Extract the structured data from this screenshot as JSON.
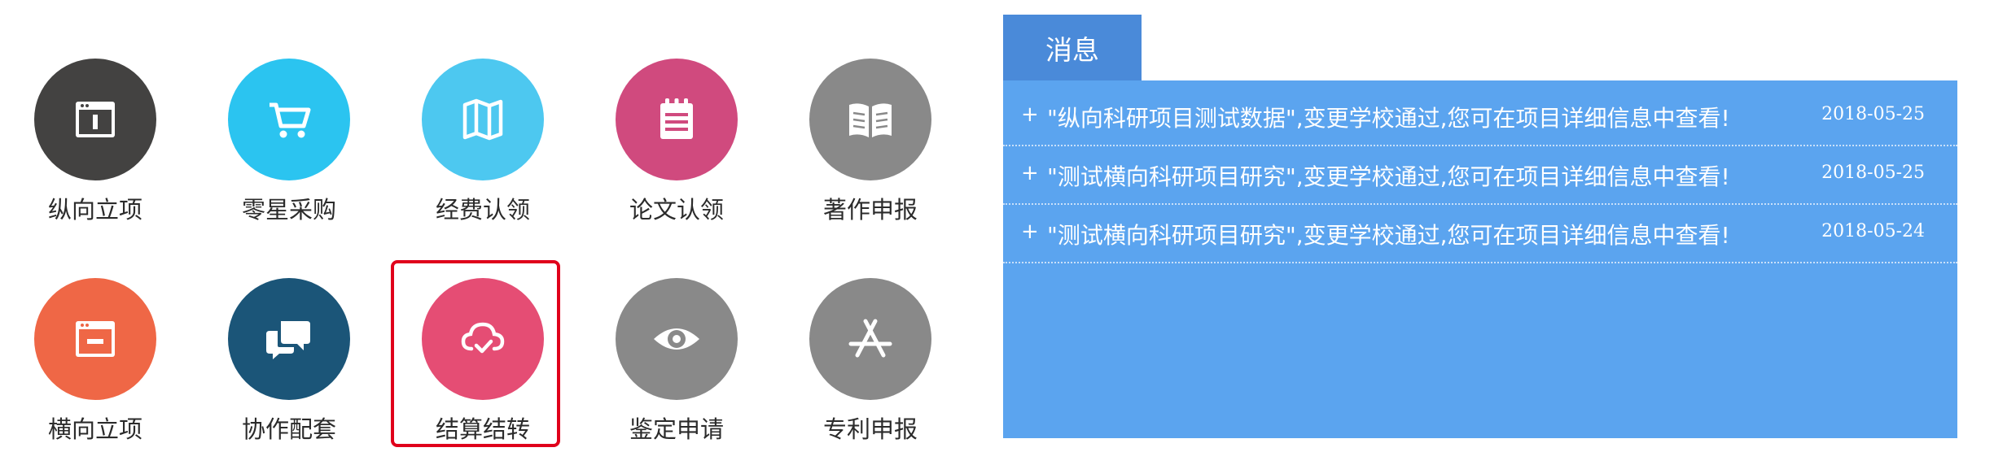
{
  "tiles": [
    {
      "label": "纵向立项",
      "icon": "window-icon",
      "color": "#434241"
    },
    {
      "label": "零星采购",
      "icon": "cart-icon",
      "color": "#2bc4f0"
    },
    {
      "label": "经费认领",
      "icon": "map-icon",
      "color": "#4dc8f0"
    },
    {
      "label": "论文认领",
      "icon": "notepad-icon",
      "color": "#d04a7e"
    },
    {
      "label": "著作申报",
      "icon": "book-icon",
      "color": "#898989"
    },
    {
      "label": "横向立项",
      "icon": "window-minus-icon",
      "color": "#ef6746"
    },
    {
      "label": "协作配套",
      "icon": "chat-icon",
      "color": "#1b5578"
    },
    {
      "label": "结算结转",
      "icon": "cloud-check-icon",
      "color": "#e54d74"
    },
    {
      "label": "鉴定申请",
      "icon": "eye-icon",
      "color": "#898989"
    },
    {
      "label": "专利申报",
      "icon": "appstore-icon",
      "color": "#898989"
    }
  ],
  "messages": {
    "tab_label": "消息",
    "items": [
      {
        "bullet": "+",
        "text": "\"纵向科研项目测试数据\",变更学校通过,您可在项目详细信息中查看!",
        "date": "2018-05-25"
      },
      {
        "bullet": "+",
        "text": "\"测试横向科研项目研究\",变更学校通过,您可在项目详细信息中查看!",
        "date": "2018-05-25"
      },
      {
        "bullet": "+",
        "text": "\"测试横向科研项目研究\",变更学校通过,您可在项目详细信息中查看!",
        "date": "2018-05-24"
      }
    ]
  },
  "colors": {
    "panel": "#5ba4ef",
    "tab": "#4a8ad9",
    "highlight": "#e0001b"
  }
}
